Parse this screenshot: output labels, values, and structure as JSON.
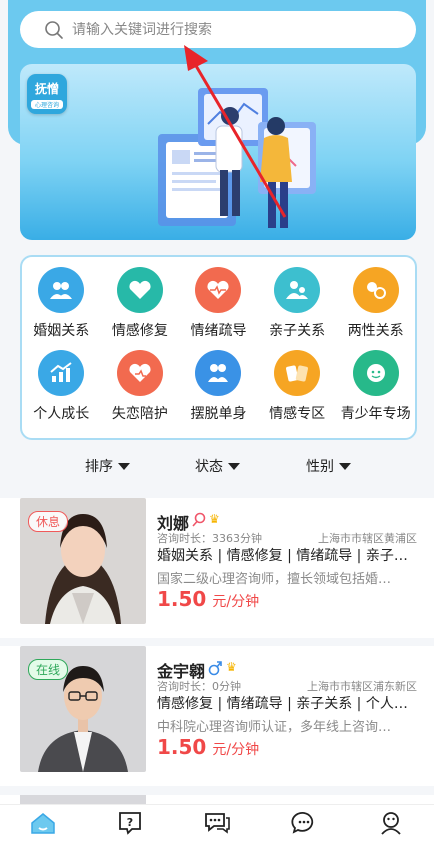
{
  "search": {
    "placeholder": "请输入关键词进行搜索"
  },
  "banner": {
    "logo_top": "抚憎",
    "logo_bottom": "心理咨询"
  },
  "categories": [
    {
      "label": "婚姻关系",
      "icon": "marriage-icon",
      "color": "#3aa8e6"
    },
    {
      "label": "情感修复",
      "icon": "heart-repair-icon",
      "color": "#27b9a8"
    },
    {
      "label": "情绪疏导",
      "icon": "emotion-icon",
      "color": "#f26a4f"
    },
    {
      "label": "亲子关系",
      "icon": "parent-child-icon",
      "color": "#3dbfcf"
    },
    {
      "label": "两性关系",
      "icon": "gender-icon",
      "color": "#f6a523"
    },
    {
      "label": "个人成长",
      "icon": "growth-icon",
      "color": "#3aa8e6"
    },
    {
      "label": "失恋陪护",
      "icon": "heartbreak-icon",
      "color": "#f26a4f"
    },
    {
      "label": "摆脱单身",
      "icon": "single-icon",
      "color": "#3a92e6"
    },
    {
      "label": "情感专区",
      "icon": "cards-icon",
      "color": "#f6a523"
    },
    {
      "label": "青少年专场",
      "icon": "teen-icon",
      "color": "#27b98a"
    }
  ],
  "filters": {
    "sort": "排序",
    "status": "状态",
    "gender": "性别"
  },
  "counselors": [
    {
      "status": "休息",
      "name": "刘娜",
      "gender_icon": "female-icon",
      "duration": "咨询时长：3363分钟",
      "location": "上海市市辖区黄浦区",
      "tags": "婚姻关系 | 情感修复 | 情绪疏导 | 亲子关系",
      "intro": "国家二级心理咨询师，擅长领域包括婚姻情感",
      "price": "1.50",
      "unit": "元/分钟"
    },
    {
      "status": "在线",
      "name": "金宇翱",
      "gender_icon": "male-icon",
      "duration": "咨询时长：0分钟",
      "location": "上海市市辖区浦东新区",
      "tags": "情感修复 | 情绪疏导 | 亲子关系 | 个人成长",
      "intro": "中科院心理咨询师认证，多年线上咨询经验",
      "price": "1.50",
      "unit": "元/分钟"
    }
  ],
  "tabbar": [
    "home-icon",
    "question-icon",
    "chat-icon",
    "message-icon",
    "profile-icon"
  ],
  "colors": {
    "accent": "#3aa8e6",
    "price": "#f04848",
    "banner": "#6cc9ef"
  }
}
